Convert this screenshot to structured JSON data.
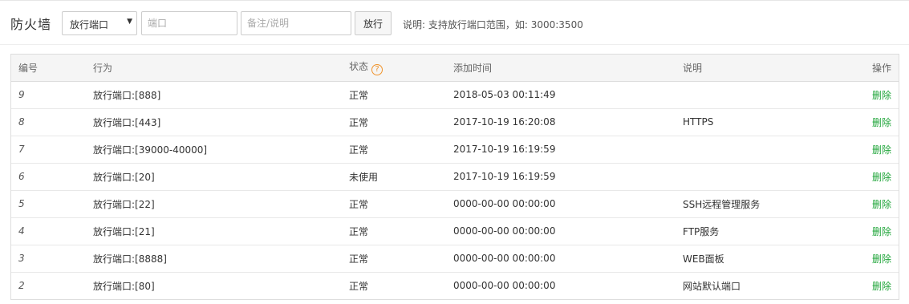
{
  "header": {
    "title": "防火墙",
    "select_value": "放行端口",
    "port_placeholder": "端口",
    "remark_placeholder": "备注/说明",
    "add_button": "放行",
    "hint": "说明: 支持放行端口范围，如: 3000:3500"
  },
  "table": {
    "columns": {
      "id": "编号",
      "action": "行为",
      "status": "状态",
      "time": "添加时间",
      "desc": "说明",
      "op": "操作"
    },
    "help_icon_glyph": "?",
    "rows": [
      {
        "id": "9",
        "action": "放行端口:[888]",
        "status": "正常",
        "time": "2018-05-03 00:11:49",
        "desc": "",
        "op": "删除"
      },
      {
        "id": "8",
        "action": "放行端口:[443]",
        "status": "正常",
        "time": "2017-10-19 16:20:08",
        "desc": "HTTPS",
        "op": "删除"
      },
      {
        "id": "7",
        "action": "放行端口:[39000-40000]",
        "status": "正常",
        "time": "2017-10-19 16:19:59",
        "desc": "",
        "op": "删除"
      },
      {
        "id": "6",
        "action": "放行端口:[20]",
        "status": "未使用",
        "time": "2017-10-19 16:19:59",
        "desc": "",
        "op": "删除"
      },
      {
        "id": "5",
        "action": "放行端口:[22]",
        "status": "正常",
        "time": "0000-00-00 00:00:00",
        "desc": "SSH远程管理服务",
        "op": "删除"
      },
      {
        "id": "4",
        "action": "放行端口:[21]",
        "status": "正常",
        "time": "0000-00-00 00:00:00",
        "desc": "FTP服务",
        "op": "删除"
      },
      {
        "id": "3",
        "action": "放行端口:[8888]",
        "status": "正常",
        "time": "0000-00-00 00:00:00",
        "desc": "WEB面板",
        "op": "删除"
      },
      {
        "id": "2",
        "action": "放行端口:[80]",
        "status": "正常",
        "time": "0000-00-00 00:00:00",
        "desc": "网站默认端口",
        "op": "删除"
      }
    ]
  },
  "colors": {
    "accent_green": "#20a53a",
    "help_orange": "#f0932b"
  }
}
